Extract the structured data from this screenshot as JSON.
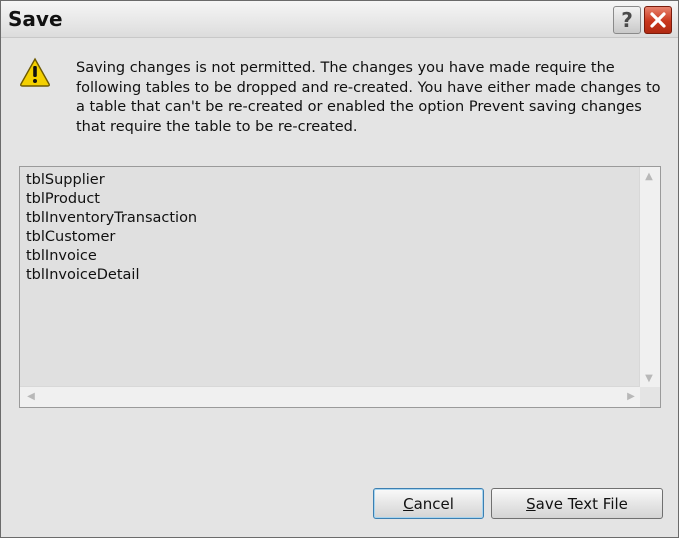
{
  "window": {
    "title": "Save",
    "help_label": "?"
  },
  "message": "Saving changes is not permitted. The changes you have made require the following tables to be dropped and re-created. You have either made changes to a table that can't be re-created or enabled the option Prevent saving changes that require the table to be re-created.",
  "tables": [
    "tblSupplier",
    "tblProduct",
    "tblInventoryTransaction",
    "tblCustomer",
    "tblInvoice",
    "tblInvoiceDetail"
  ],
  "buttons": {
    "cancel": {
      "mnemonic": "C",
      "rest": "ancel"
    },
    "save_text_file": {
      "mnemonic": "S",
      "rest": "ave Text File"
    }
  },
  "icons": {
    "warning": "warning-icon",
    "close": "close-icon",
    "help": "help-icon"
  },
  "colors": {
    "close_button": "#c9361c",
    "warning_fill": "#f4d000",
    "dialog_bg": "#e4e4e4"
  }
}
